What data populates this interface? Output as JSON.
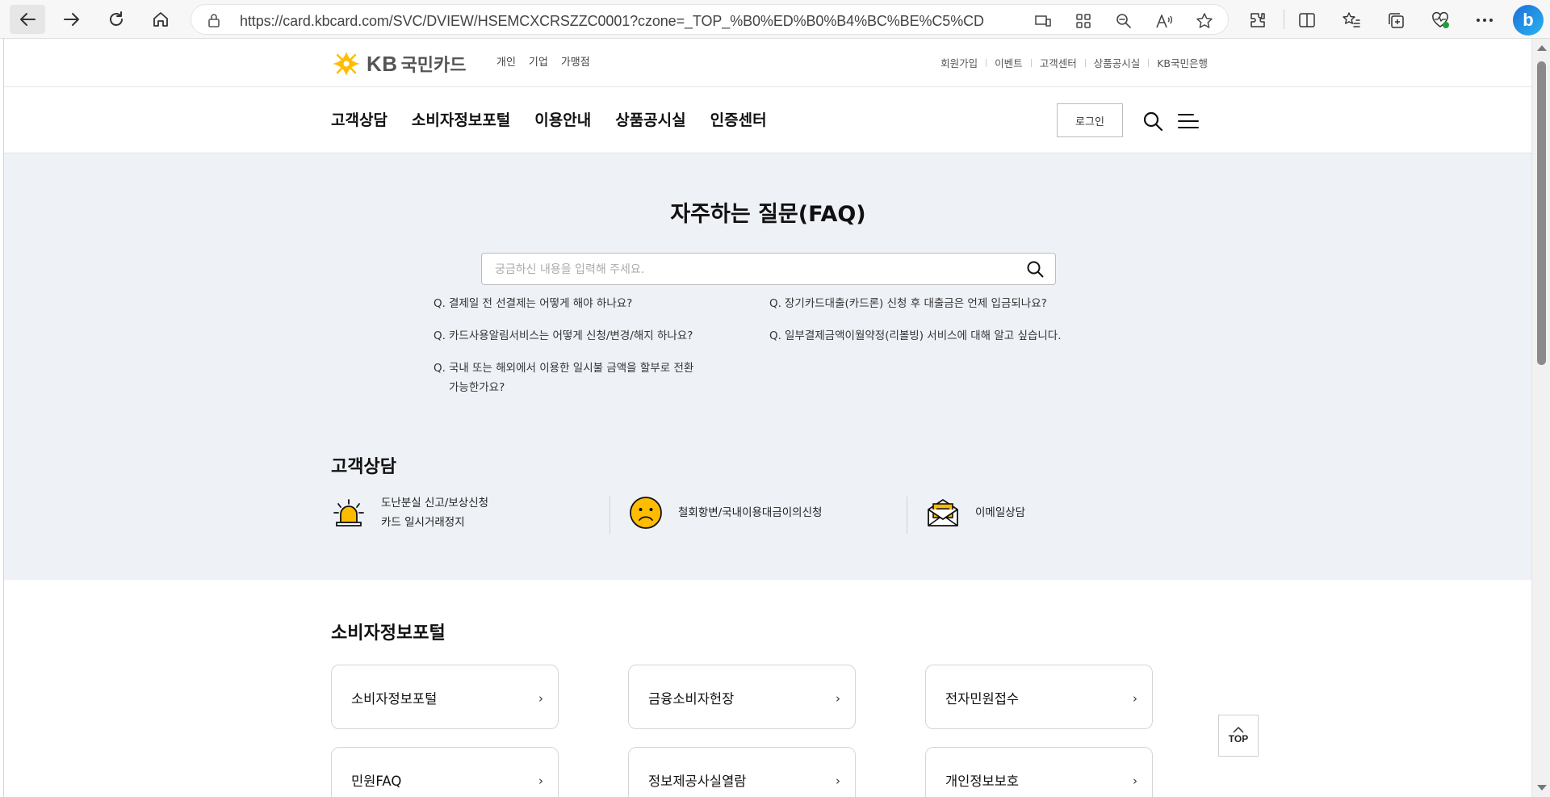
{
  "browser": {
    "url": "https://card.kbcard.com/SVC/DVIEW/HSEMCXCRSZZC0001?czone=_TOP_%B0%ED%B0%B4%BC%BE%C5%CD",
    "icons": [
      "back-icon",
      "forward-icon",
      "refresh-icon",
      "home-icon",
      "lock-icon",
      "device-icon",
      "app-grid-icon",
      "zoom-out-icon",
      "read-aloud-icon",
      "favorite-star-icon",
      "extensions-icon",
      "split-screen-icon",
      "favorites-list-icon",
      "collections-icon",
      "health-icon",
      "more-icon",
      "bing-icon"
    ],
    "bing_label": "b"
  },
  "site": {
    "logo_kb": "KB",
    "logo_name": "국민카드",
    "brand_color": "#ffbc00",
    "segments": [
      "개인",
      "기업",
      "가맹점"
    ],
    "util_links": [
      "회원가입",
      "이벤트",
      "고객센터",
      "상품공시실",
      "KB국민은행"
    ],
    "gnb": [
      "고객상담",
      "소비자정보포털",
      "이용안내",
      "상품공시실",
      "인증센터"
    ],
    "login_label": "로그인"
  },
  "faq": {
    "title": "자주하는 질문(FAQ)",
    "search_placeholder": "궁금하신 내용을 입력해 주세요.",
    "q_prefix": "Q.",
    "items": [
      "결제일 전 선결제는 어떻게 해야 하나요?",
      "장기카드대출(카드론) 신청 후 대출금은 언제 입금되나요?",
      "카드사용알림서비스는 어떻게 신청/변경/해지 하나요?",
      "일부결제금액이월약정(리볼빙) 서비스에 대해 알고 싶습니다.",
      "국내 또는 해외에서 이용한 일시불 금액을 할부로 전환",
      "가능한가요?"
    ]
  },
  "consult": {
    "title": "고객상담",
    "items": [
      {
        "line1": "도난분실 신고/보상신청",
        "line2": "카드 일시거래정지"
      },
      {
        "line1": "철회항변/국내이용대금이의신청"
      },
      {
        "line1": "이메일상담"
      }
    ]
  },
  "portal": {
    "title": "소비자정보포털",
    "cards": [
      "소비자정보포털",
      "금융소비자헌장",
      "전자민원접수",
      "민원FAQ",
      "정보제공사실열람",
      "개인정보보호"
    ],
    "chevron": "›"
  },
  "top_button": "TOP"
}
